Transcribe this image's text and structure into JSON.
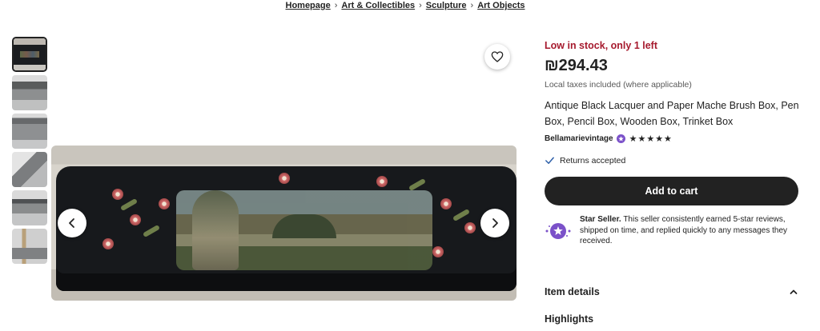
{
  "breadcrumb": {
    "items": [
      "Homepage",
      "Art & Collectibles",
      "Sculpture",
      "Art Objects"
    ]
  },
  "gallery": {
    "thumbnail_count": 6,
    "active_index": 0
  },
  "product": {
    "stock_notice": "Low in stock, only 1 left",
    "price": "₪294.43",
    "tax_note": "Local taxes included (where applicable)",
    "title": "Antique Black Lacquer and Paper Mache Brush Box, Pen Box, Pencil Box, Wooden Box, Trinket Box",
    "shop_name": "Bellamarievintage",
    "rating_stars": 5,
    "stars_display": "★★★★★",
    "returns": "Returns accepted",
    "add_to_cart": "Add to cart"
  },
  "star_seller": {
    "label": "Star Seller.",
    "description": "This seller consistently earned 5-star reviews, shipped on time, and replied quickly to any messages they received."
  },
  "sections": {
    "item_details": "Item details",
    "highlights": "Highlights"
  },
  "colors": {
    "stock_red": "#a61a2e",
    "cart_button": "#222222",
    "star_seller_purple": "#7b51c9",
    "returns_check": "#2c5ea8"
  },
  "icons": {
    "favorite": "heart-icon",
    "prev": "chevron-left-icon",
    "next": "chevron-right-icon",
    "returns": "check-icon",
    "star_seller": "star-seller-badge-icon",
    "item_details_toggle": "chevron-up-icon"
  }
}
